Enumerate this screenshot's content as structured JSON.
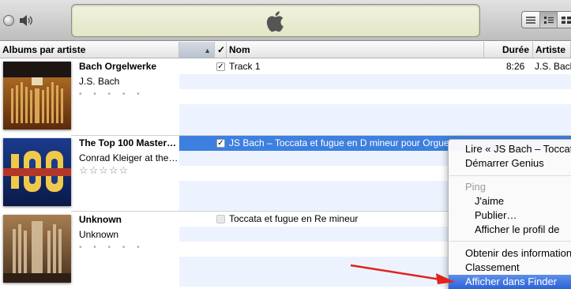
{
  "toolbar": {
    "view_modes": [
      "list-view",
      "album-list-view",
      "grid-view"
    ]
  },
  "header": {
    "albums_by_artist": "Albums par artiste",
    "sort_indicator": "▲",
    "check_col": "✓",
    "name": "Nom",
    "duration": "Durée",
    "artist": "Artiste"
  },
  "albums": [
    {
      "title": "Bach Orgelwerke",
      "artist": "J.S. Bach",
      "stars": "• • • • •"
    },
    {
      "title": "The Top 100 Master…",
      "artist": "Conrad Kleiger at the…",
      "stars": "☆☆☆☆☆"
    },
    {
      "title": "Unknown",
      "artist": "Unknown",
      "stars": "• • • • •"
    }
  ],
  "tracks": [
    {
      "check": "✓",
      "name": "Track  1",
      "duration": "8:26",
      "artist": "J.S. Bach"
    },
    {
      "check": "✓",
      "name": "JS Bach – Toccata et fugue en D mineur pour Orgue",
      "duration": "",
      "artist": ""
    },
    {
      "check": "",
      "name": "Toccata et fugue en Re mineur",
      "duration": "",
      "artist": ""
    }
  ],
  "context_menu": {
    "play": "Lire « JS Bach – Toccata",
    "genius": "Démarrer Genius",
    "ping": "Ping",
    "like": "J'aime",
    "publish": "Publier…",
    "profile": "Afficher le profil de",
    "get_info": "Obtenir des informations",
    "rating": "Classement",
    "show_in_finder": "Afficher dans Finder"
  },
  "colors": {
    "selection": "#3d80df",
    "menu_highlight": "#2d62d8",
    "annotation_arrow": "#e0231c"
  }
}
